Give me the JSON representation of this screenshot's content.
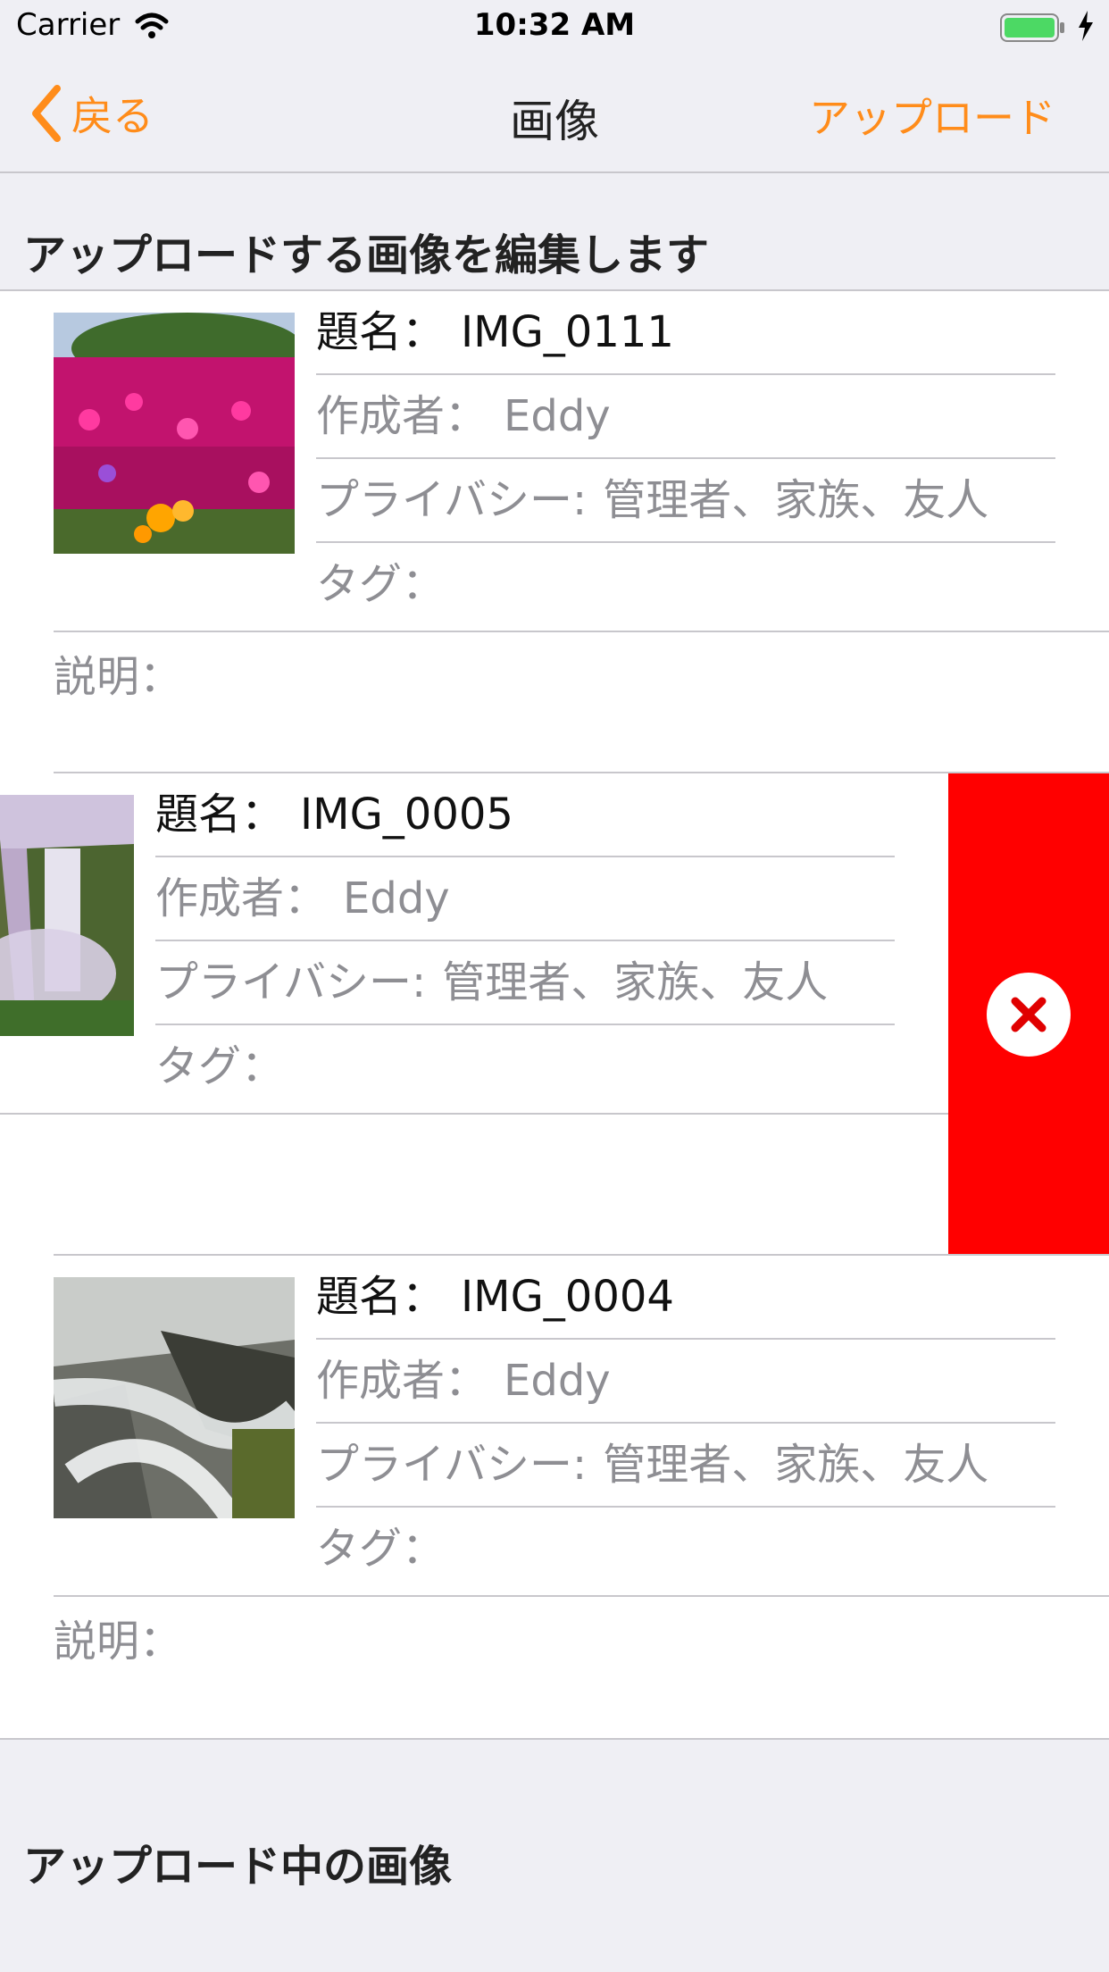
{
  "status": {
    "carrier": "Carrier",
    "time": "10:32 AM"
  },
  "nav": {
    "back_label": "戻る",
    "title": "画像",
    "upload_label": "アップロード"
  },
  "sections": {
    "edit_header": "アップロードする画像を編集します",
    "uploading_header": "アップロード中の画像"
  },
  "labels": {
    "title": "題名：",
    "creator": "作成者：",
    "privacy": "プライバシー:",
    "tags": "タグ：",
    "description": "説明："
  },
  "images": [
    {
      "title": "IMG_0111",
      "creator": "Eddy",
      "privacy": "管理者、家族、友人",
      "tags": "",
      "description": ""
    },
    {
      "title": "IMG_0005",
      "creator": "Eddy",
      "privacy": "管理者、家族、友人",
      "tags": "",
      "description": ""
    },
    {
      "title": "IMG_0004",
      "creator": "Eddy",
      "privacy": "管理者、家族、友人",
      "tags": "",
      "description": ""
    }
  ],
  "colors": {
    "accent": "#ff8c1a",
    "delete": "#ff0000",
    "background": "#efeff4"
  }
}
